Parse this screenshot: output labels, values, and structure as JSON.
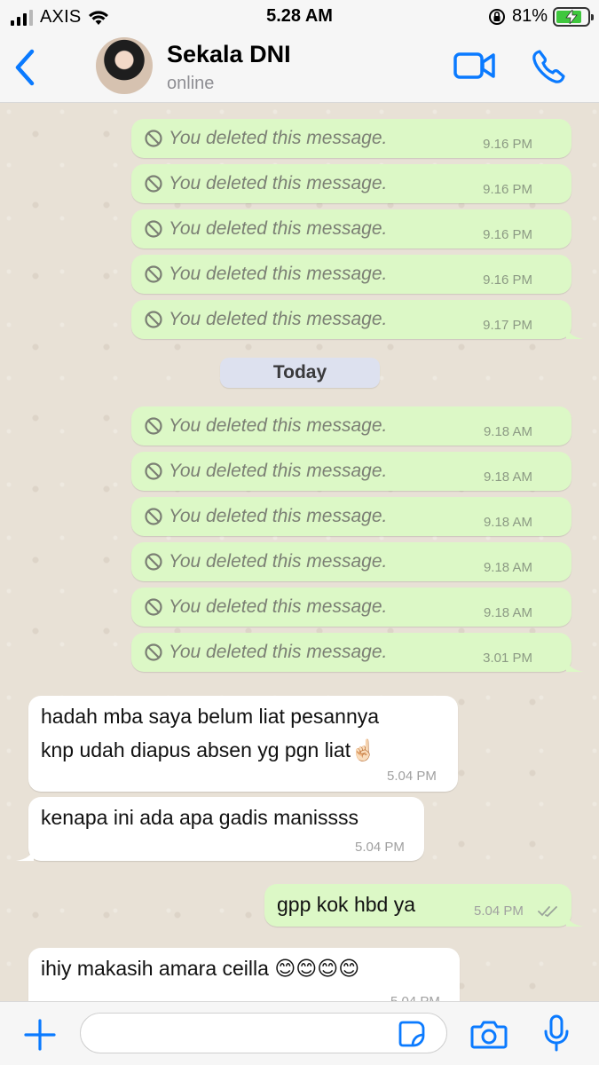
{
  "status_bar": {
    "carrier": "AXIS",
    "time": "5.28 AM",
    "battery": "81%",
    "battery_level": 0.81
  },
  "header": {
    "contact_name": "Sekala DNI",
    "contact_status": "online"
  },
  "chat": {
    "deleted_text": "You deleted this message.",
    "date_separator": "Today",
    "messages": [
      {
        "type": "deleted",
        "direction": "out",
        "time": "9.16 PM"
      },
      {
        "type": "deleted",
        "direction": "out",
        "time": "9.16 PM"
      },
      {
        "type": "deleted",
        "direction": "out",
        "time": "9.16 PM"
      },
      {
        "type": "deleted",
        "direction": "out",
        "time": "9.16 PM"
      },
      {
        "type": "deleted",
        "direction": "out",
        "time": "9.17 PM"
      },
      {
        "type": "deleted",
        "direction": "out",
        "time": "9.18 AM"
      },
      {
        "type": "deleted",
        "direction": "out",
        "time": "9.18 AM"
      },
      {
        "type": "deleted",
        "direction": "out",
        "time": "9.18 AM"
      },
      {
        "type": "deleted",
        "direction": "out",
        "time": "9.18 AM"
      },
      {
        "type": "deleted",
        "direction": "out",
        "time": "9.18 AM"
      },
      {
        "type": "deleted",
        "direction": "out",
        "time": "3.01 PM"
      },
      {
        "type": "text",
        "direction": "in",
        "lines": [
          "hadah mba saya belum liat pesannya",
          "knp udah diapus absen yg pgn liat☝🏻"
        ],
        "time": "5.04 PM"
      },
      {
        "type": "text",
        "direction": "in",
        "lines": [
          "kenapa ini ada apa gadis manissss"
        ],
        "time": "5.04 PM"
      },
      {
        "type": "text",
        "direction": "out",
        "lines": [
          "gpp kok hbd ya"
        ],
        "time": "5.04 PM",
        "status": "read"
      },
      {
        "type": "text",
        "direction": "in",
        "lines": [
          "ihiy makasih amara ceilla 😊😊😊😊"
        ],
        "time": "5.04 PM"
      }
    ]
  },
  "input_bar": {
    "value": "",
    "placeholder": ""
  },
  "icons": {
    "back": "chevron-left-icon",
    "video": "video-camera-icon",
    "call": "phone-icon",
    "plus": "plus-icon",
    "sticker": "sticker-icon",
    "camera": "camera-icon",
    "mic": "microphone-icon",
    "deleted": "prohibited-icon",
    "read": "double-check-icon"
  },
  "colors": {
    "accent": "#0a7aff",
    "outgoing_bubble": "#dcf8c6",
    "incoming_bubble": "#ffffff",
    "date_chip": "#dde1ef",
    "battery_fill": "#3fc73e"
  }
}
